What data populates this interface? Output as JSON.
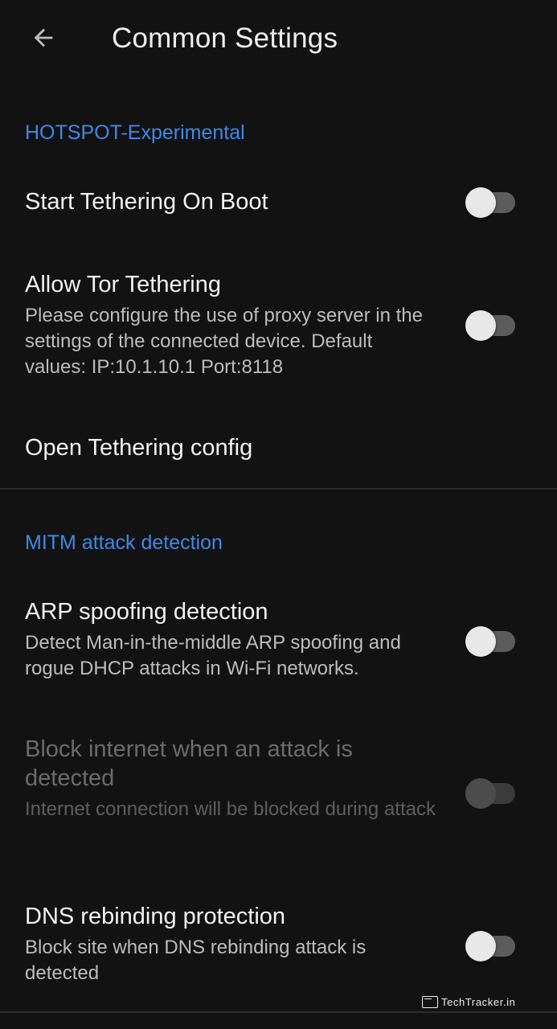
{
  "toolbar": {
    "title": "Common Settings",
    "back_icon": "arrow-left-icon"
  },
  "sections": {
    "hotspot": {
      "header": "HOTSPOT-Experimental",
      "start_tethering": {
        "title": "Start Tethering On Boot",
        "enabled": false
      },
      "allow_tor": {
        "title": "Allow Tor Tethering",
        "summary": "Please configure the use of proxy server in the settings of the connected device. Default values: IP:10.1.10.1 Port:8118",
        "enabled": false
      },
      "open_config": {
        "title": "Open Tethering config"
      }
    },
    "mitm": {
      "header": "MITM attack detection",
      "arp": {
        "title": "ARP spoofing detection",
        "summary": "Detect Man-in-the-middle ARP spoofing and rogue DHCP attacks in Wi-Fi networks.",
        "enabled": false
      },
      "block_internet": {
        "title": "Block internet when an attack is detected",
        "summary": "Internet connection will be blocked during attack",
        "enabled": false,
        "disabled": true
      },
      "dns": {
        "title": "DNS rebinding protection",
        "summary": "Block site when DNS rebinding attack is detected",
        "enabled": false
      }
    }
  },
  "colors": {
    "background": "#121212",
    "accent": "#3d8ae8",
    "text_primary": "#f2f2f2",
    "text_secondary": "#bdbdbd"
  },
  "watermark": "TechTracker.in"
}
